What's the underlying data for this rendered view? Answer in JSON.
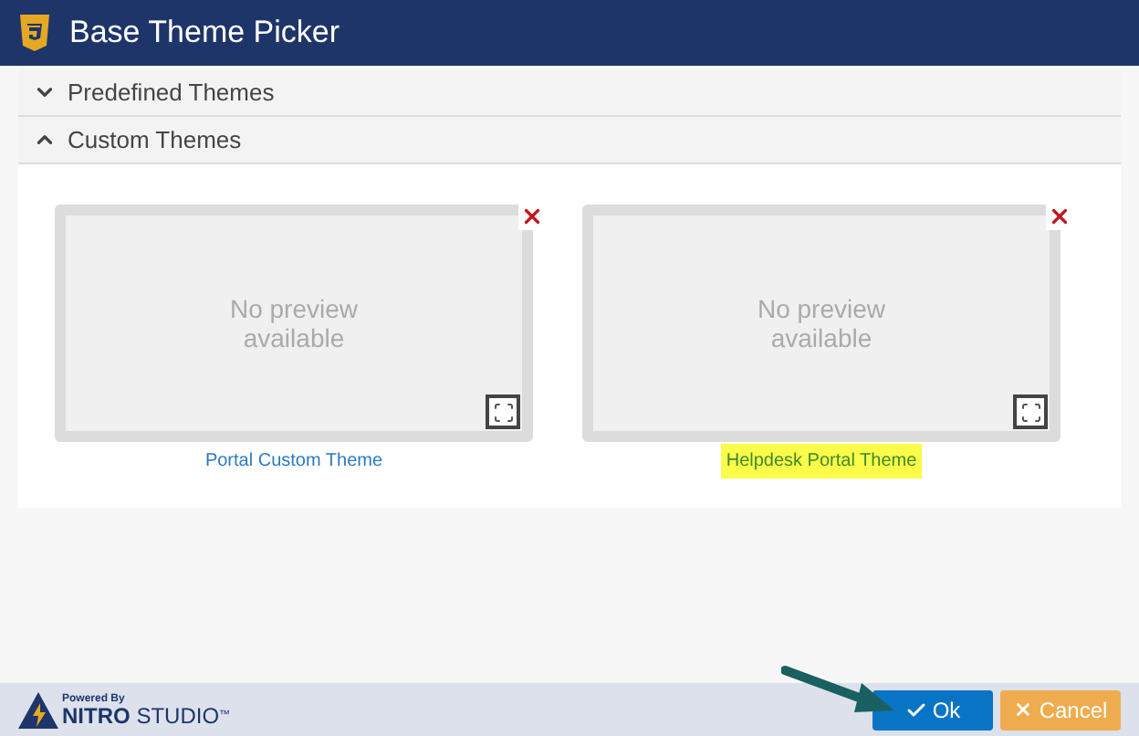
{
  "window": {
    "title": "Base Theme Picker"
  },
  "sections": [
    {
      "label": "Predefined Themes",
      "expanded": false
    },
    {
      "label": "Custom Themes",
      "expanded": true
    }
  ],
  "themes": [
    {
      "preview": "No preview available",
      "name": "Portal Custom Theme",
      "selected": false
    },
    {
      "preview": "No preview available",
      "name": "Helpdesk Portal Theme",
      "selected": true
    }
  ],
  "footer": {
    "powered_by": "Powered By",
    "brand_bold": "NITRO",
    "brand": "STUDIO",
    "trademark": "™"
  },
  "buttons": [
    {
      "kind": "ok",
      "label": "Ok"
    },
    {
      "kind": "cancel",
      "label": "Cancel"
    }
  ]
}
